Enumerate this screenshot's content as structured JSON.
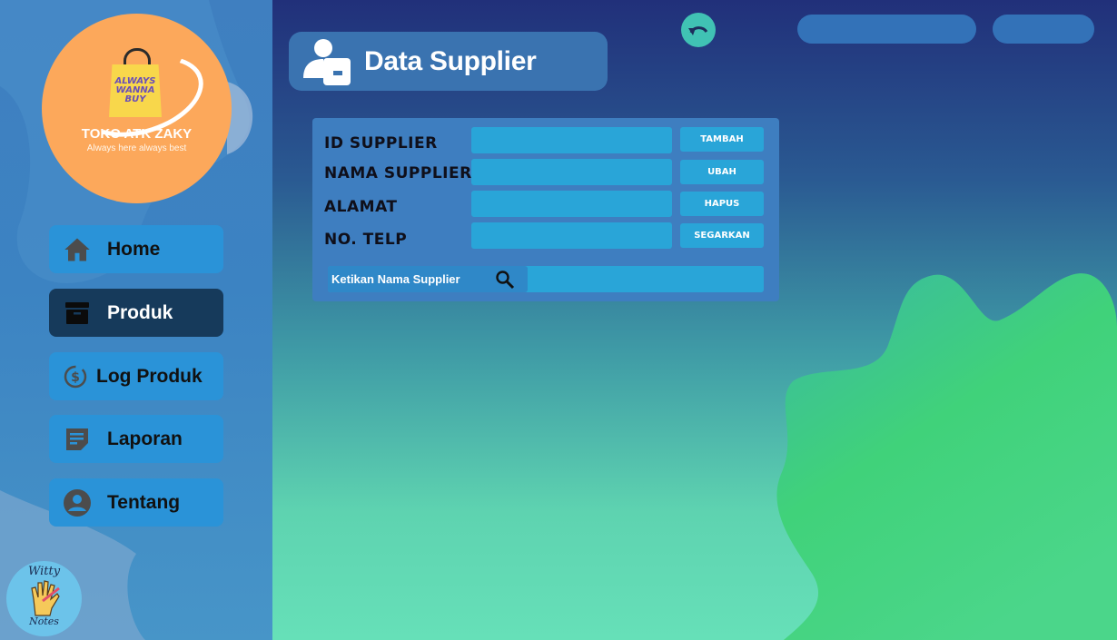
{
  "sidebar": {
    "logo": {
      "bag_text": "ALWAYS WANNA BUY",
      "brand": "TOKO ATK ZAKY",
      "tagline": "Always here always best"
    },
    "items": [
      {
        "label": "Home",
        "icon": "home-icon"
      },
      {
        "label": "Produk",
        "icon": "archive-icon",
        "active": true
      },
      {
        "label": "Log Produk",
        "icon": "money-history-icon"
      },
      {
        "label": "Laporan",
        "icon": "note-icon"
      },
      {
        "label": "Tentang",
        "icon": "user-circle-icon"
      }
    ],
    "mascot": {
      "top_text": "Witty",
      "bottom_text": "Notes"
    }
  },
  "header": {
    "title": "Data Supplier",
    "title_icon": "supplier-icon",
    "back_icon": "undo-icon"
  },
  "form": {
    "fields": [
      {
        "label": "ID SUPPLIER",
        "value": ""
      },
      {
        "label": "NAMA SUPPLIER",
        "value": ""
      },
      {
        "label": "ALAMAT",
        "value": ""
      },
      {
        "label": "NO. TELP",
        "value": ""
      }
    ],
    "buttons": [
      "TAMBAH",
      "UBAH",
      "HAPUS",
      "SEGARKAN"
    ],
    "search": {
      "placeholder": "Ketikan Nama Supplier",
      "icon": "search-icon"
    }
  },
  "colors": {
    "sidebar_bg": "#3f7fc0",
    "nav_item": "#2a93d8",
    "nav_active": "#163a5b",
    "logo_bg": "#fca85b",
    "input_bg": "#29a5d8",
    "accent_green": "#40d27a"
  }
}
